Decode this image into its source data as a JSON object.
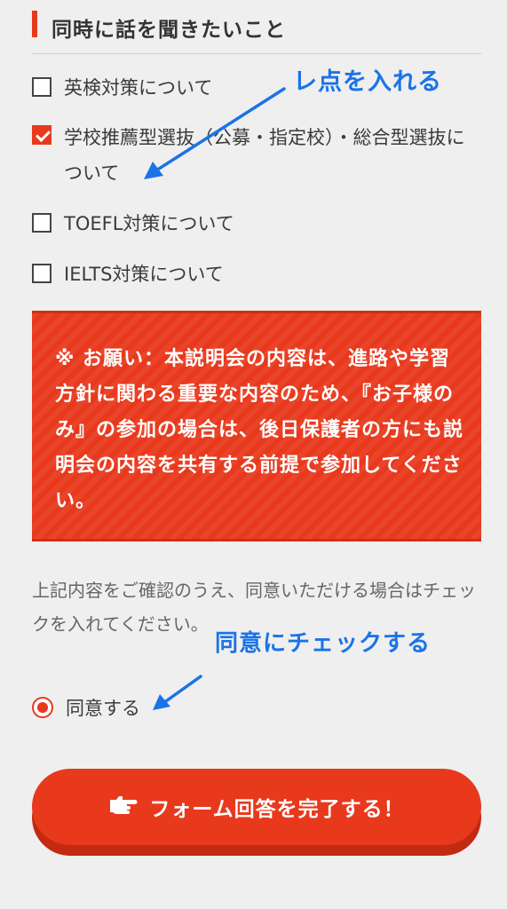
{
  "section": {
    "title": "同時に話を聞きたいこと"
  },
  "options": [
    {
      "label": "英検対策について",
      "checked": false
    },
    {
      "label": "学校推薦型選抜（公募・指定校）・総合型選抜について",
      "checked": true
    },
    {
      "label": "TOEFL対策について",
      "checked": false
    },
    {
      "label": "IELTS対策について",
      "checked": false
    }
  ],
  "notice": {
    "text": "※ お願い：本説明会の内容は、進路や学習方針に関わる重要な内容のため、『お子様のみ』の参加の場合は、後日保護者の方にも説明会の内容を共有する前提で参加してください。"
  },
  "confirm": {
    "text": "上記内容をご確認のうえ、同意いただける場合はチェックを入れてください。"
  },
  "agree": {
    "label": "同意する",
    "selected": true
  },
  "submit": {
    "label": "フォーム回答を完了する！",
    "icon": "pointing-hand-icon"
  },
  "annotations": {
    "check_hint": "レ点を入れる",
    "agree_hint": "同意にチェックする"
  },
  "colors": {
    "accent": "#e8391d",
    "annotation": "#1a73e8"
  }
}
